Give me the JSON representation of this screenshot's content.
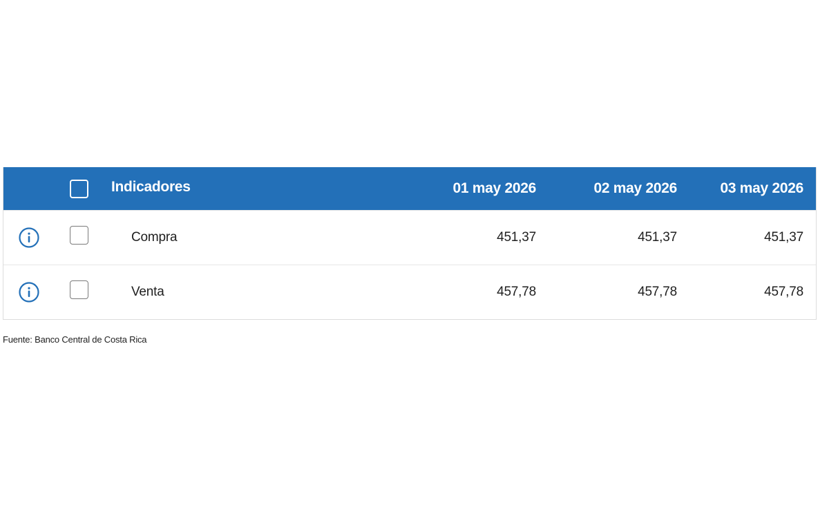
{
  "table": {
    "header": {
      "indicators_label": "Indicadores",
      "dates": [
        "01 may 2026",
        "02 may 2026",
        "03 may 2026"
      ]
    },
    "rows": [
      {
        "label": "Compra",
        "values": [
          "451,37",
          "451,37",
          "451,37"
        ]
      },
      {
        "label": "Venta",
        "values": [
          "457,78",
          "457,78",
          "457,78"
        ]
      }
    ]
  },
  "source": "Fuente: Banco Central de Costa Rica",
  "colors": {
    "header_bg": "#2370b8",
    "info_icon": "#2370b8",
    "text": "#1f1f1f"
  },
  "icons": {
    "row_info": "info-icon",
    "checkbox": "checkbox-icon"
  }
}
